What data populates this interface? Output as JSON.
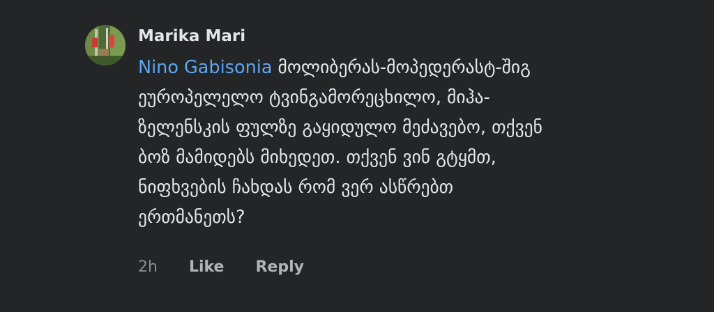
{
  "comment": {
    "author": "Marika Mari",
    "avatar_icon": "profile-photo-icon",
    "mention": "Nino Gabisonia",
    "text_lines": [
      " მოლიბერას-მოპედერასტ-შიგ",
      "ეუროპელელო ტვინგამორეცხილო, მიჰა-",
      "ზელენსკის ფულზე გაყიდულო მეძავებო, თქვენ",
      "ბოზ მამიდებს მიხედეთ. თქვენ ვინ გტყმთ,",
      "ნიფხვების ჩახდას რომ ვერ ასწრებთ",
      "ერთმანეთს?"
    ],
    "timestamp": "2h",
    "like_label": "Like",
    "reply_label": "Reply"
  },
  "colors": {
    "background": "#242526",
    "text": "#e4e6eb",
    "mention": "#5aa7f2",
    "secondary": "#b0b3b8"
  }
}
